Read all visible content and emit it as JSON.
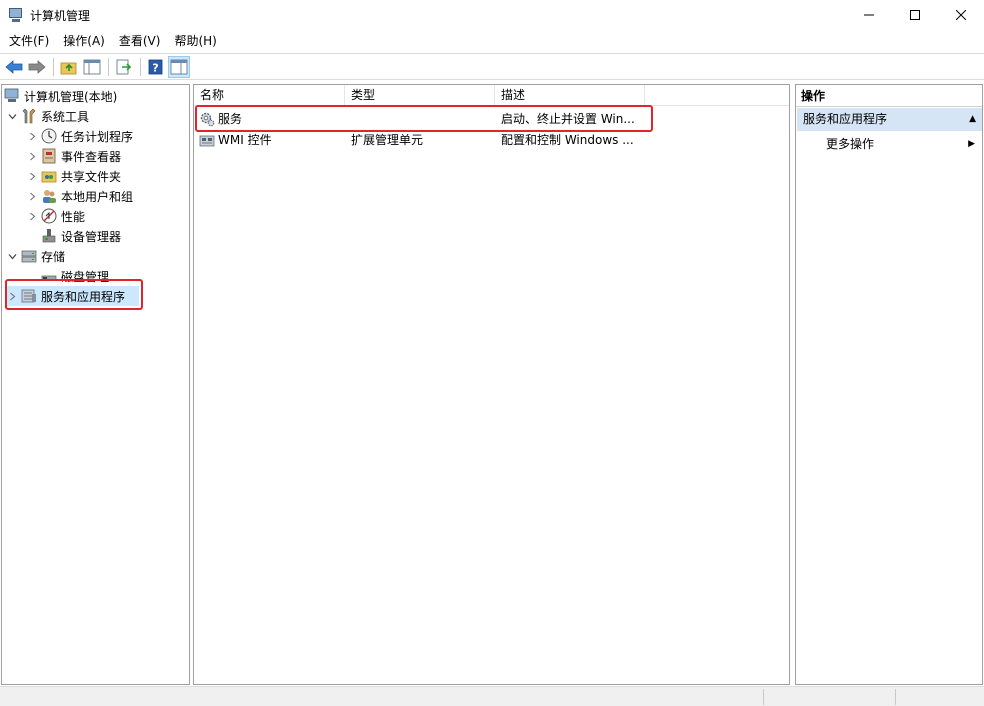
{
  "window": {
    "title": "计算机管理"
  },
  "menu": [
    {
      "label": "文件(F)"
    },
    {
      "label": "操作(A)"
    },
    {
      "label": "查看(V)"
    },
    {
      "label": "帮助(H)"
    }
  ],
  "toolbar": {
    "icons": [
      "back-arrow-icon",
      "forward-arrow-icon",
      "up-folder-icon",
      "show-hide-tree-icon",
      "export-list-icon",
      "help-icon",
      "show-hide-action-pane-icon"
    ]
  },
  "tree": {
    "root": "计算机管理(本地)",
    "items": [
      {
        "label": "系统工具"
      },
      {
        "label": "任务计划程序"
      },
      {
        "label": "事件查看器"
      },
      {
        "label": "共享文件夹"
      },
      {
        "label": "本地用户和组"
      },
      {
        "label": "性能"
      },
      {
        "label": "设备管理器"
      },
      {
        "label": "存储"
      },
      {
        "label": "磁盘管理"
      },
      {
        "label": "服务和应用程序"
      }
    ]
  },
  "list": {
    "columns": [
      "名称",
      "类型",
      "描述"
    ],
    "rows": [
      {
        "name": "服务",
        "type": "",
        "desc": "启动、终止并设置 Win..."
      },
      {
        "name": "WMI 控件",
        "type": "扩展管理单元",
        "desc": "配置和控制 Windows ..."
      }
    ]
  },
  "actions": {
    "title": "操作",
    "section": "服务和应用程序",
    "more": "更多操作"
  },
  "colors": {
    "highlight": "#e0262b",
    "selection": "#cce8ff",
    "action_section": "#d5e5f5"
  }
}
